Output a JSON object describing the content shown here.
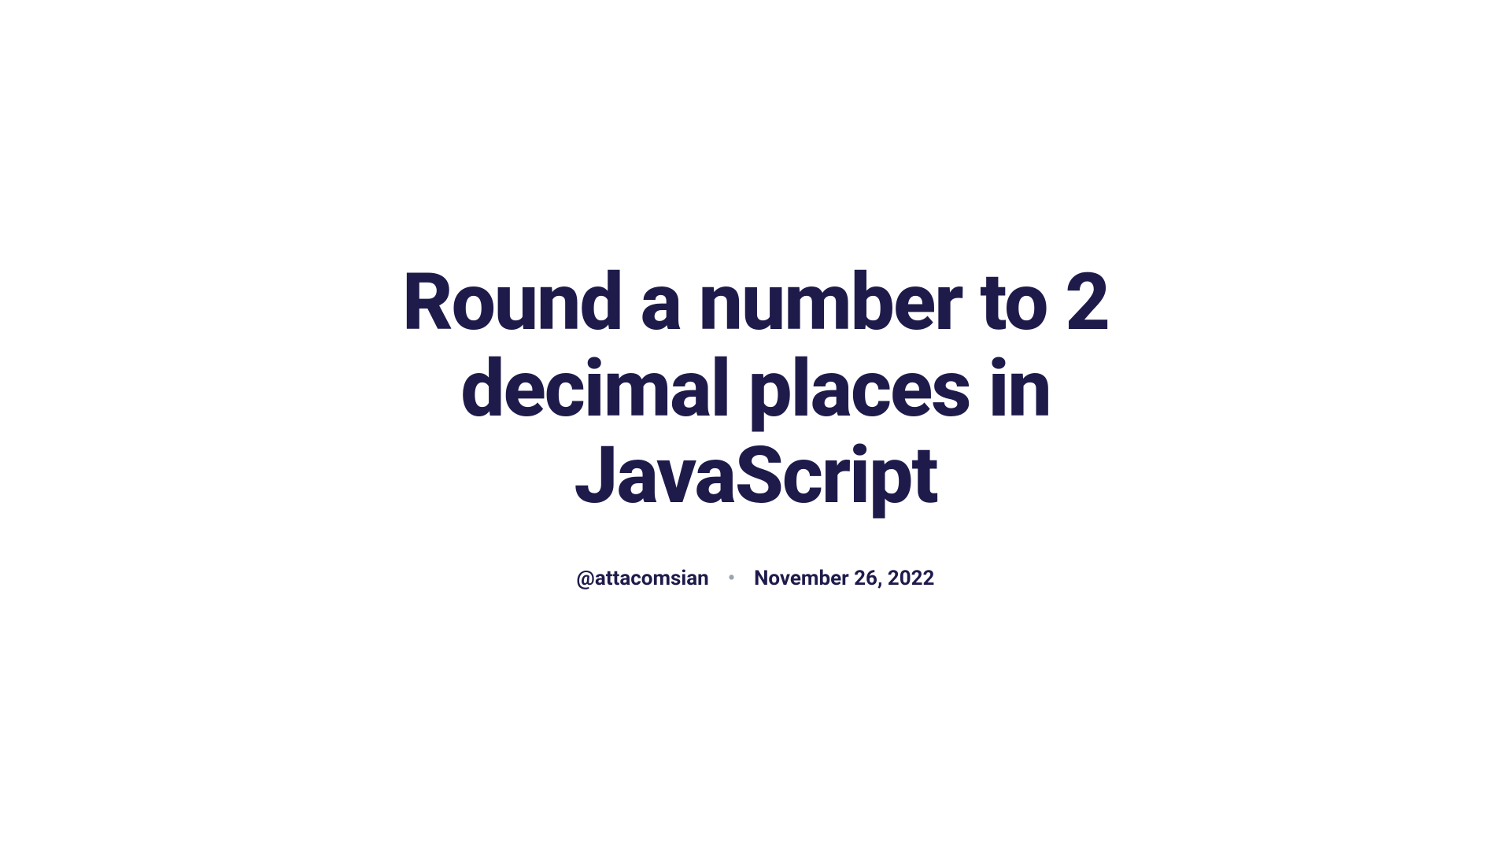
{
  "article": {
    "title": "Round a number to 2 decimal places in JavaScript",
    "author": "@attacomsian",
    "date": "November 26, 2022"
  },
  "separator": "•"
}
